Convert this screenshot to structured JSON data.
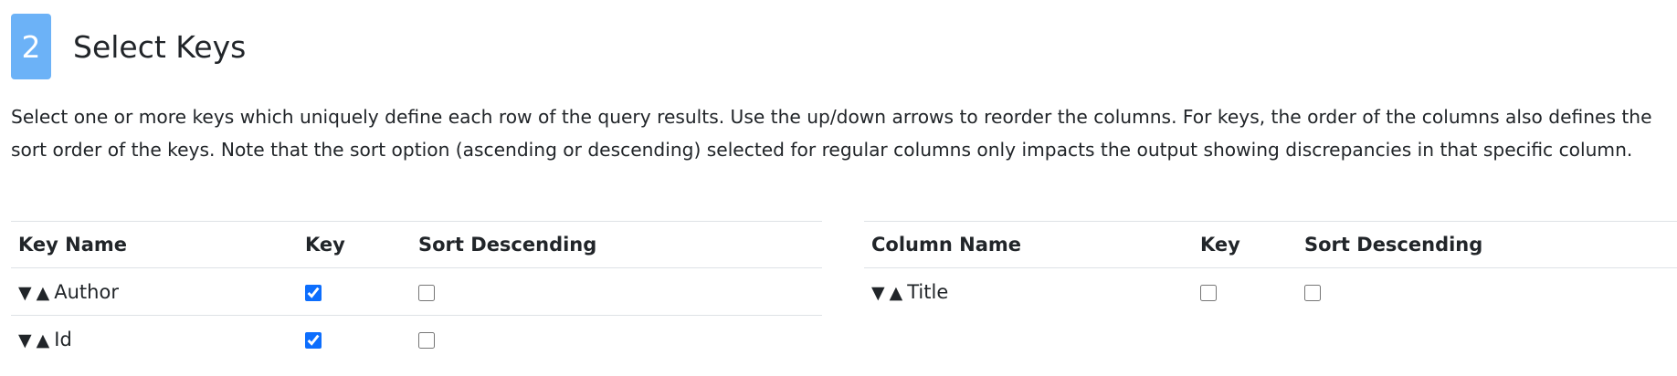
{
  "section": {
    "step_number": "2",
    "title": "Select Keys",
    "description": "Select one or more keys which uniquely define each row of the query results. Use the up/down arrows to reorder the columns. For keys, the order of the columns also defines the sort order of the keys. Note that the sort option (ascending or descending) selected for regular columns only impacts the output showing discrepancies in that specific column."
  },
  "icons": {
    "move_down": "▼",
    "move_up": "▲"
  },
  "key_table": {
    "headers": [
      "Key Name",
      "Key",
      "Sort Descending"
    ],
    "rows": [
      {
        "name": "Author",
        "key": true,
        "sort_descending": false
      },
      {
        "name": "Id",
        "key": true,
        "sort_descending": false
      }
    ]
  },
  "column_table": {
    "headers": [
      "Column Name",
      "Key",
      "Sort Descending"
    ],
    "rows": [
      {
        "name": "Title",
        "key": false,
        "sort_descending": false
      }
    ]
  },
  "colors": {
    "badge": "#6cb2f7",
    "checkbox_checked": "#0d6efd",
    "text": "#212529",
    "border": "#dee2e6"
  }
}
